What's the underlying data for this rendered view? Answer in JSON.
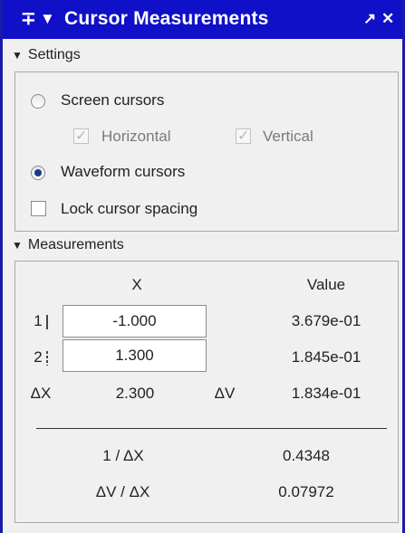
{
  "titlebar": {
    "title": "Cursor Measurements",
    "pin_glyph": "∓",
    "menu_glyph": "▼",
    "undock_glyph": "↗",
    "close_glyph": "✕",
    "background": "#1010c8"
  },
  "settings": {
    "header": "Settings",
    "screen_cursors": {
      "label": "Screen cursors",
      "selected": false
    },
    "horizontal": {
      "label": "Horizontal",
      "checked": true,
      "enabled": false
    },
    "vertical": {
      "label": "Vertical",
      "checked": true,
      "enabled": false
    },
    "waveform_cursors": {
      "label": "Waveform cursors",
      "selected": true
    },
    "lock_spacing": {
      "label": "Lock cursor spacing",
      "checked": false
    }
  },
  "measurements": {
    "header": "Measurements",
    "col_x": "X",
    "col_value": "Value",
    "rows": [
      {
        "label": "1",
        "x": "-1.000",
        "value": "3.679e-01",
        "marker": "solid"
      },
      {
        "label": "2",
        "x": "1.300",
        "value": "1.845e-01",
        "marker": "dashed"
      }
    ],
    "delta": {
      "dx_label": "ΔX",
      "dx_value": "2.300",
      "dv_label": "ΔV",
      "dv_value": "1.834e-01"
    },
    "inv_dx": {
      "label": "1 / ΔX",
      "value": "0.4348"
    },
    "dv_over_dx": {
      "label": "ΔV / ΔX",
      "value": "0.07972"
    }
  }
}
